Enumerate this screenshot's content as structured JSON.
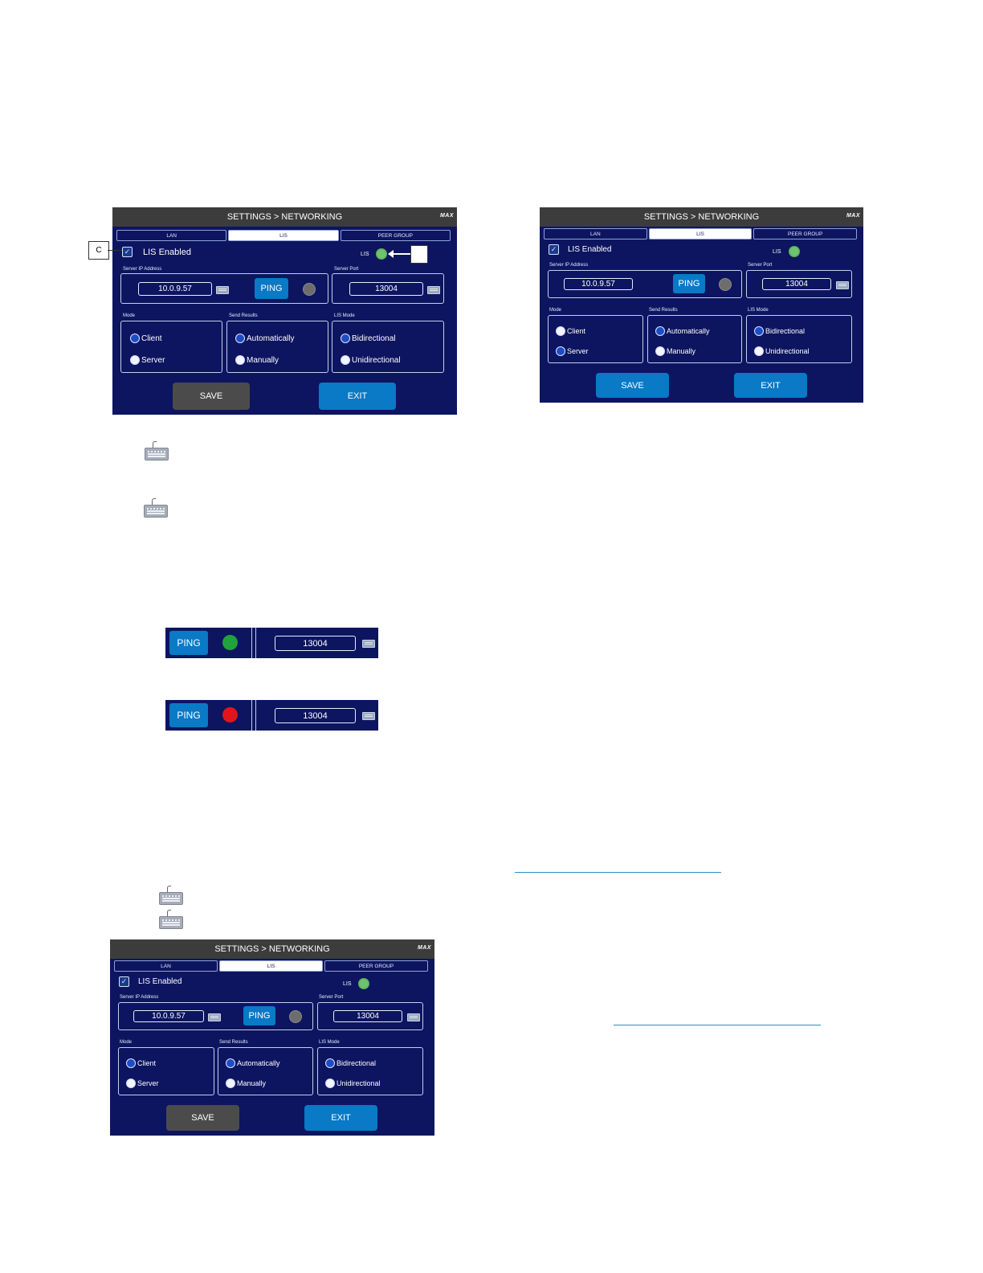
{
  "screen": {
    "title": "SETTINGS > NETWORKING",
    "logo": "MAX",
    "tabs": [
      "LAN",
      "LIS",
      "PEER GROUP"
    ],
    "lis_enabled_label": "LIS Enabled",
    "lis_indicator_label": "LIS",
    "server_ip_label": "Server IP Address",
    "server_ip_value": "10.0.9.57",
    "ping_label": "PING",
    "server_port_label": "Server Port",
    "server_port_value": "13004",
    "mode_label": "Mode",
    "mode_options": [
      "Client",
      "Server"
    ],
    "send_results_label": "Send Results",
    "send_results_options": [
      "Automatically",
      "Manually"
    ],
    "lis_mode_label": "LIS Mode",
    "lis_mode_options": [
      "Bidirectional",
      "Unidirectional"
    ],
    "save_label": "SAVE",
    "exit_label": "EXIT"
  },
  "callout": {
    "c_label": "C",
    "d_label": ""
  },
  "strips": {
    "ping_label": "PING",
    "port_value": "13004"
  },
  "colors": {
    "panel": "#0d1560",
    "accent": "#0a79c6",
    "ok": "#1fa33a",
    "fail": "#e3141c"
  },
  "icons": {
    "keyboard": "keyboard-icon",
    "checkmark": "checkmark-icon"
  }
}
